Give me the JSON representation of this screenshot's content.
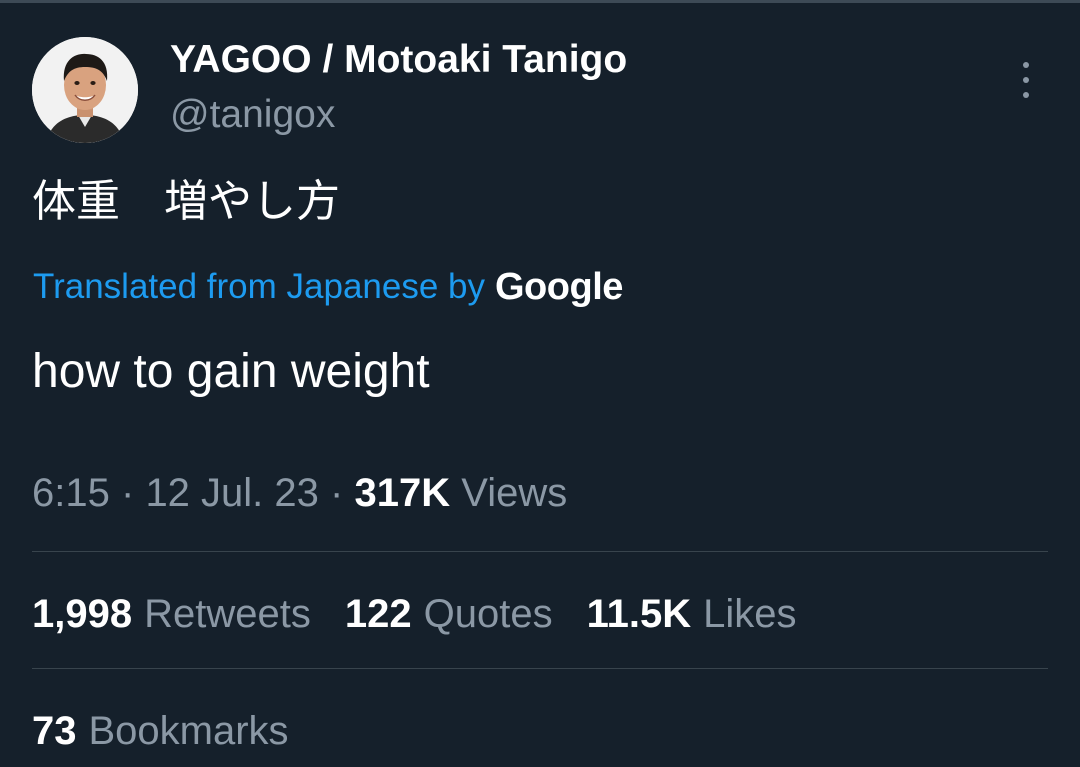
{
  "author": {
    "display_name": "YAGOO / Motoaki Tanigo",
    "handle": "@tanigox",
    "avatar_icon": "profile-photo"
  },
  "menu": {
    "more_icon": "more-vertical-icon"
  },
  "tweet": {
    "original_text": "体重　増やし方",
    "translation_label": "Translated from Japanese by",
    "translation_provider": "Google",
    "translated_text": "how to gain weight"
  },
  "meta": {
    "time": "6:15",
    "date": "12 Jul. 23",
    "separator": "·",
    "views_count": "317K",
    "views_label": "Views"
  },
  "stats": [
    {
      "count": "1,998",
      "label": "Retweets"
    },
    {
      "count": "122",
      "label": "Quotes"
    },
    {
      "count": "11.5K",
      "label": "Likes"
    }
  ],
  "bookmarks": {
    "count": "73",
    "label": "Bookmarks"
  },
  "colors": {
    "background": "#15202b",
    "text_primary": "#ffffff",
    "text_secondary": "#8b98a5",
    "link": "#1d9bf0",
    "divider": "#38444d"
  }
}
